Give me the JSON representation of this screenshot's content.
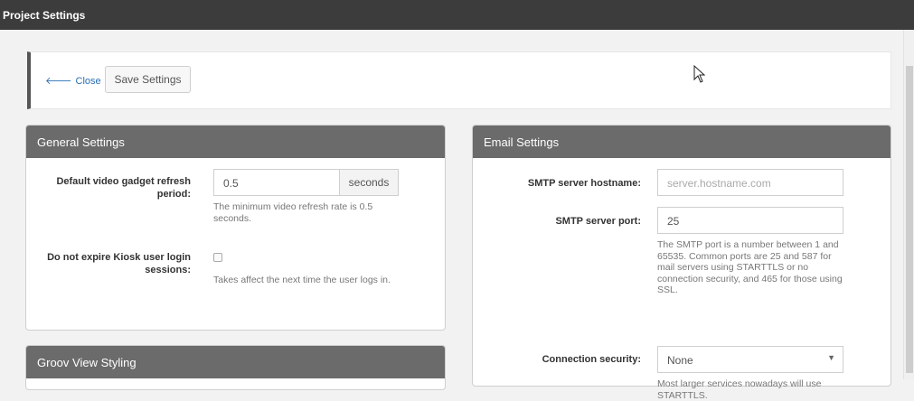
{
  "window": {
    "title": "Project Settings"
  },
  "toolbar": {
    "close_label": "Close",
    "save_label": "Save Settings"
  },
  "general": {
    "title": "General Settings",
    "refresh_label": "Default video gadget refresh period:",
    "refresh_value": "0.5",
    "refresh_unit": "seconds",
    "refresh_help": "The minimum video refresh rate is 0.5 seconds.",
    "kiosk_label": "Do not expire Kiosk user login sessions:",
    "kiosk_checked": false,
    "kiosk_help": "Takes affect the next time the user logs in."
  },
  "groov": {
    "title": "Groov View Styling"
  },
  "email": {
    "title": "Email Settings",
    "hostname_label": "SMTP server hostname:",
    "hostname_placeholder": "server.hostname.com",
    "port_label": "SMTP server port:",
    "port_value": "25",
    "port_help": "The SMTP port is a number between 1 and 65535. Common ports are 25 and 587 for mail servers using STARTTLS or no connection security, and 465 for those using SSL.",
    "security_label": "Connection security:",
    "security_value": "None",
    "security_help": "Most larger services nowadays will use STARTTLS."
  },
  "colors": {
    "titlebar": "#3c3c3c",
    "panel_header": "#6b6b6b",
    "link": "#2a6fb5"
  }
}
